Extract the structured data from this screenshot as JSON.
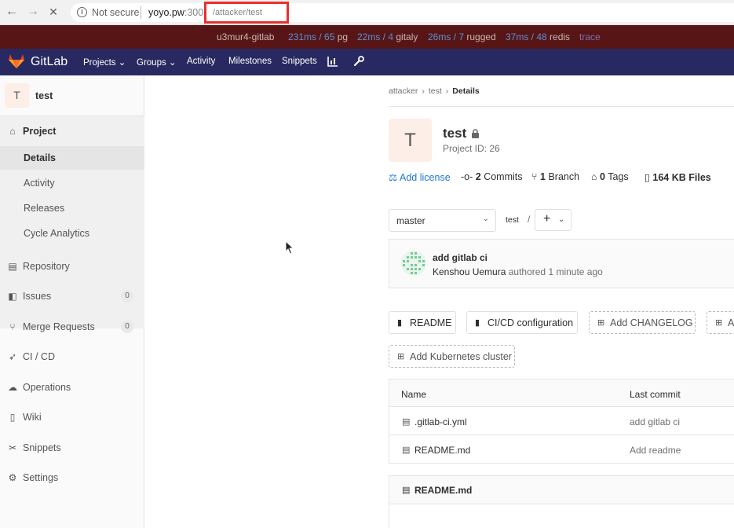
{
  "browser": {
    "back_icon": "←",
    "forward_icon": "→",
    "stop_icon": "✕",
    "insecure_label": "Not secure",
    "host": "yoyo.pw",
    "port": ":300",
    "path": "/attacker/test"
  },
  "perf": {
    "host": "u3mur4-gitlab",
    "pg_val": "231ms / 65",
    "pg_label": "pg",
    "gitaly_val": "22ms / 4",
    "gitaly_label": "gitaly",
    "rugged_val": "26ms / 7",
    "rugged_label": "rugged",
    "redis_val": "37ms / 48",
    "redis_label": "redis",
    "trace_label": "trace"
  },
  "navbar": {
    "brand": "GitLab",
    "projects": "Projects ⌄",
    "groups": "Groups ⌄",
    "activity": "Activity",
    "milestones": "Milestones",
    "snippets": "Snippets",
    "chart_icon": "chart-icon",
    "wrench_icon": "wrench-icon"
  },
  "sidebar": {
    "avatar_letter": "T",
    "project_name": "test",
    "project_label": "Project",
    "sub_items": [
      "Details",
      "Activity",
      "Releases",
      "Cycle Analytics"
    ],
    "items": [
      {
        "label": "Repository",
        "icon": "repository-icon"
      },
      {
        "label": "Issues",
        "icon": "issues-icon",
        "badge": "0"
      },
      {
        "label": "Merge Requests",
        "icon": "merge-request-icon",
        "badge": "0"
      },
      {
        "label": "CI / CD",
        "icon": "rocket-icon"
      },
      {
        "label": "Operations",
        "icon": "cloud-icon"
      },
      {
        "label": "Wiki",
        "icon": "book-icon"
      },
      {
        "label": "Snippets",
        "icon": "scissors-icon"
      },
      {
        "label": "Settings",
        "icon": "gear-icon"
      }
    ]
  },
  "breadcrumb": {
    "owner": "attacker",
    "project": "test",
    "current": "Details"
  },
  "project": {
    "avatar_letter": "T",
    "title": "test",
    "id_text": "Project ID: 26"
  },
  "stats": {
    "license": "Add license",
    "commits_n": "2",
    "commits_l": "Commits",
    "branch_n": "1",
    "branch_l": "Branch",
    "tags_n": "0",
    "tags_l": "Tags",
    "files_n": "164 KB",
    "files_l": "Files"
  },
  "repo": {
    "branch": "master",
    "path": "test",
    "slash": "/",
    "plus": "+"
  },
  "commit": {
    "title": "add gitlab ci",
    "author": "Kenshou Uemura",
    "meta": "authored 1 minute ago"
  },
  "quick_buttons": {
    "readme": "README",
    "cicd": "CI/CD configuration",
    "changelog": "Add CHANGELOG",
    "partial": "A",
    "kubernetes": "Add Kubernetes cluster"
  },
  "file_table": {
    "col_name": "Name",
    "col_commit": "Last commit",
    "rows": [
      {
        "name": ".gitlab-ci.yml",
        "commit": "add gitlab ci"
      },
      {
        "name": "README.md",
        "commit": "Add readme"
      }
    ]
  },
  "readme": {
    "title": "README.md"
  }
}
